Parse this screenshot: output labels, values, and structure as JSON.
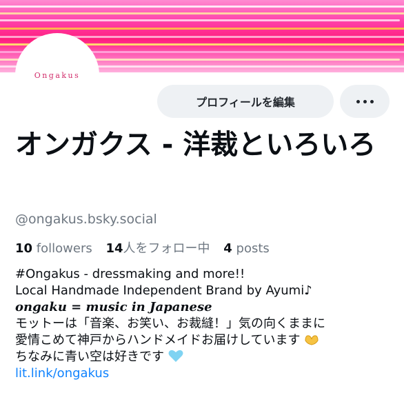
{
  "banner": {
    "image": "neon-lights-banner"
  },
  "profile": {
    "avatar_text": "Ongakus",
    "display_name": "オンガクス - 洋裁といろいろ",
    "handle": "@ongakus.bsky.social"
  },
  "actions": {
    "edit_profile_label": "プロフィールを編集",
    "more_icon": "ellipsis-icon"
  },
  "stats": {
    "followers_count": "10",
    "followers_label": "followers",
    "following_count": "14",
    "following_label": "人をフォロー中",
    "posts_count": "4",
    "posts_label": "posts"
  },
  "bio": {
    "line1": "#Ongakus - dressmaking and more!!",
    "line2": "Local Handmade Independent Brand by Ayumi♪",
    "line3": "ongaku = music in Japanese",
    "line4": "モットーは「音楽、お笑い、お裁縫！」気の向くままに",
    "line5": "愛情こめて神戸からハンドメイドお届けしています",
    "line6": "ちなみに青い空は好きです",
    "link": "lit.link/ongakus"
  },
  "colors": {
    "link": "#1083fe",
    "muted": "#6e7781",
    "button_bg": "#eef1f4",
    "heart": "#7fd3f2"
  }
}
